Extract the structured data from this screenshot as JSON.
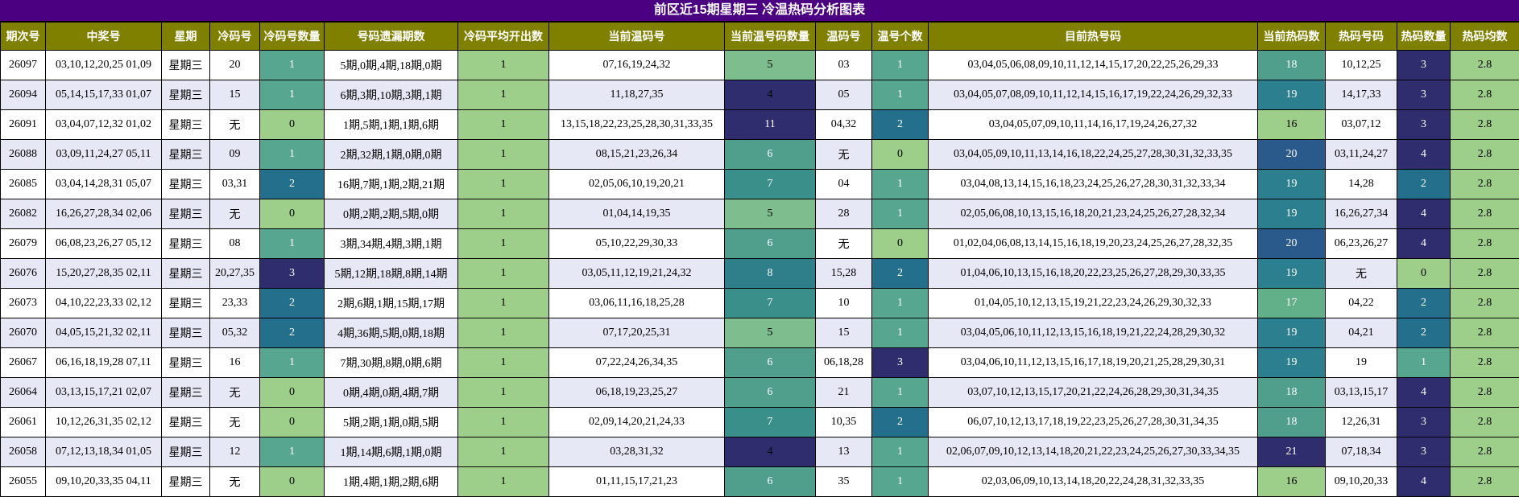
{
  "title": "前区近15期星期三 冷温热码分析图表",
  "headers": [
    "期次号",
    "中奖号",
    "星期",
    "冷码号",
    "冷码号数量",
    "号码遗漏期数",
    "冷码平均开出数",
    "当前温码号",
    "当前温号码数量",
    "温码号",
    "温号个数",
    "目前热号码",
    "当前热码数",
    "热码号码",
    "热码数量",
    "热码均数"
  ],
  "palette": {
    "0": "#9ecf8a",
    "1": "#57a690",
    "2": "#236f8c",
    "3": "#2f2d6e",
    "4": "#2f2d6e",
    "5": "#7dbd8e",
    "6": "#4f9f8c",
    "7": "#3a8f8a",
    "8": "#2e7f8a",
    "11": "#2f2d6e",
    "16": "#9ecf8a",
    "17": "#62b08a",
    "18": "#4f9f8c",
    "19": "#2b7f8e",
    "20": "#2a5a8c",
    "21": "#2f2d6e",
    "avg": "#9ecf8a"
  },
  "rows": [
    [
      "26097",
      "03,10,12,20,25 01,09",
      "星期三",
      "20",
      "1",
      "5期,0期,4期,18期,0期",
      "1",
      "07,16,19,24,32",
      "5",
      "03",
      "1",
      "03,04,05,06,08,09,10,11,12,14,15,17,20,22,25,26,29,33",
      "18",
      "10,12,25",
      "3",
      "2.8"
    ],
    [
      "26094",
      "05,14,15,17,33 01,07",
      "星期三",
      "15",
      "1",
      "6期,3期,10期,3期,1期",
      "1",
      "11,18,27,35",
      "4",
      "05",
      "1",
      "03,04,05,07,08,09,10,11,12,14,15,16,17,19,22,24,26,29,32,33",
      "19",
      "14,17,33",
      "3",
      "2.8"
    ],
    [
      "26091",
      "03,04,07,12,32 01,02",
      "星期三",
      "无",
      "0",
      "1期,5期,1期,1期,6期",
      "1",
      "13,15,18,22,23,25,28,30,31,33,35",
      "11",
      "04,32",
      "2",
      "03,04,05,07,09,10,11,14,16,17,19,24,26,27,32",
      "16",
      "03,07,12",
      "3",
      "2.8"
    ],
    [
      "26088",
      "03,09,11,24,27 05,11",
      "星期三",
      "09",
      "1",
      "2期,32期,1期,0期,0期",
      "1",
      "08,15,21,23,26,34",
      "6",
      "无",
      "0",
      "03,04,05,09,10,11,13,14,16,18,22,24,25,27,28,30,31,32,33,35",
      "20",
      "03,11,24,27",
      "4",
      "2.8"
    ],
    [
      "26085",
      "03,04,14,28,31 05,07",
      "星期三",
      "03,31",
      "2",
      "16期,7期,1期,2期,21期",
      "1",
      "02,05,06,10,19,20,21",
      "7",
      "04",
      "1",
      "03,04,08,13,14,15,16,18,23,24,25,26,27,28,30,31,32,33,34",
      "19",
      "14,28",
      "2",
      "2.8"
    ],
    [
      "26082",
      "16,26,27,28,34 02,06",
      "星期三",
      "无",
      "0",
      "0期,2期,2期,5期,0期",
      "1",
      "01,04,14,19,35",
      "5",
      "28",
      "1",
      "02,05,06,08,10,13,15,16,18,20,21,23,24,25,26,27,28,32,34",
      "19",
      "16,26,27,34",
      "4",
      "2.8"
    ],
    [
      "26079",
      "06,08,23,26,27 05,12",
      "星期三",
      "08",
      "1",
      "3期,34期,4期,3期,1期",
      "1",
      "05,10,22,29,30,33",
      "6",
      "无",
      "0",
      "01,02,04,06,08,13,14,15,16,18,19,20,23,24,25,26,27,28,32,35",
      "20",
      "06,23,26,27",
      "4",
      "2.8"
    ],
    [
      "26076",
      "15,20,27,28,35 02,11",
      "星期三",
      "20,27,35",
      "3",
      "5期,12期,18期,8期,14期",
      "1",
      "03,05,11,12,19,21,24,32",
      "8",
      "15,28",
      "2",
      "01,04,06,10,13,15,16,18,20,22,23,25,26,27,28,29,30,33,35",
      "19",
      "无",
      "0",
      "2.8"
    ],
    [
      "26073",
      "04,10,22,23,33 02,12",
      "星期三",
      "23,33",
      "2",
      "2期,6期,1期,15期,17期",
      "1",
      "03,06,11,16,18,25,28",
      "7",
      "10",
      "1",
      "01,04,05,10,12,13,15,19,21,22,23,24,26,29,30,32,33",
      "17",
      "04,22",
      "2",
      "2.8"
    ],
    [
      "26070",
      "04,05,15,21,32 02,11",
      "星期三",
      "05,32",
      "2",
      "4期,36期,5期,0期,18期",
      "1",
      "07,17,20,25,31",
      "5",
      "15",
      "1",
      "03,04,05,06,10,11,12,13,15,16,18,19,21,22,24,28,29,30,32",
      "19",
      "04,21",
      "2",
      "2.8"
    ],
    [
      "26067",
      "06,16,18,19,28 07,11",
      "星期三",
      "16",
      "1",
      "7期,30期,8期,0期,6期",
      "1",
      "07,22,24,26,34,35",
      "6",
      "06,18,28",
      "3",
      "03,04,06,10,11,12,13,15,16,17,18,19,20,21,25,28,29,30,31",
      "19",
      "19",
      "1",
      "2.8"
    ],
    [
      "26064",
      "03,13,15,17,21 02,07",
      "星期三",
      "无",
      "0",
      "0期,4期,0期,4期,7期",
      "1",
      "06,18,19,23,25,27",
      "6",
      "21",
      "1",
      "03,07,10,12,13,15,17,20,21,22,24,26,28,29,30,31,34,35",
      "18",
      "03,13,15,17",
      "4",
      "2.8"
    ],
    [
      "26061",
      "10,12,26,31,35 02,12",
      "星期三",
      "无",
      "0",
      "5期,2期,1期,0期,5期",
      "1",
      "02,09,14,20,21,24,33",
      "7",
      "10,35",
      "2",
      "06,07,10,12,13,17,18,19,22,23,25,26,27,28,30,31,34,35",
      "18",
      "12,26,31",
      "3",
      "2.8"
    ],
    [
      "26058",
      "07,12,13,18,34 01,05",
      "星期三",
      "12",
      "1",
      "1期,14期,6期,1期,0期",
      "1",
      "03,28,31,32",
      "4",
      "13",
      "1",
      "02,06,07,09,10,12,13,14,18,20,21,22,23,24,25,26,27,30,33,34,35",
      "21",
      "07,18,34",
      "3",
      "2.8"
    ],
    [
      "26055",
      "09,10,20,33,35 04,11",
      "星期三",
      "无",
      "0",
      "1期,4期,1期,2期,6期",
      "1",
      "01,11,15,17,21,23",
      "6",
      "35",
      "1",
      "02,03,06,09,10,13,14,18,20,22,24,28,31,32,33,35",
      "16",
      "09,10,20,33",
      "4",
      "2.8"
    ]
  ]
}
